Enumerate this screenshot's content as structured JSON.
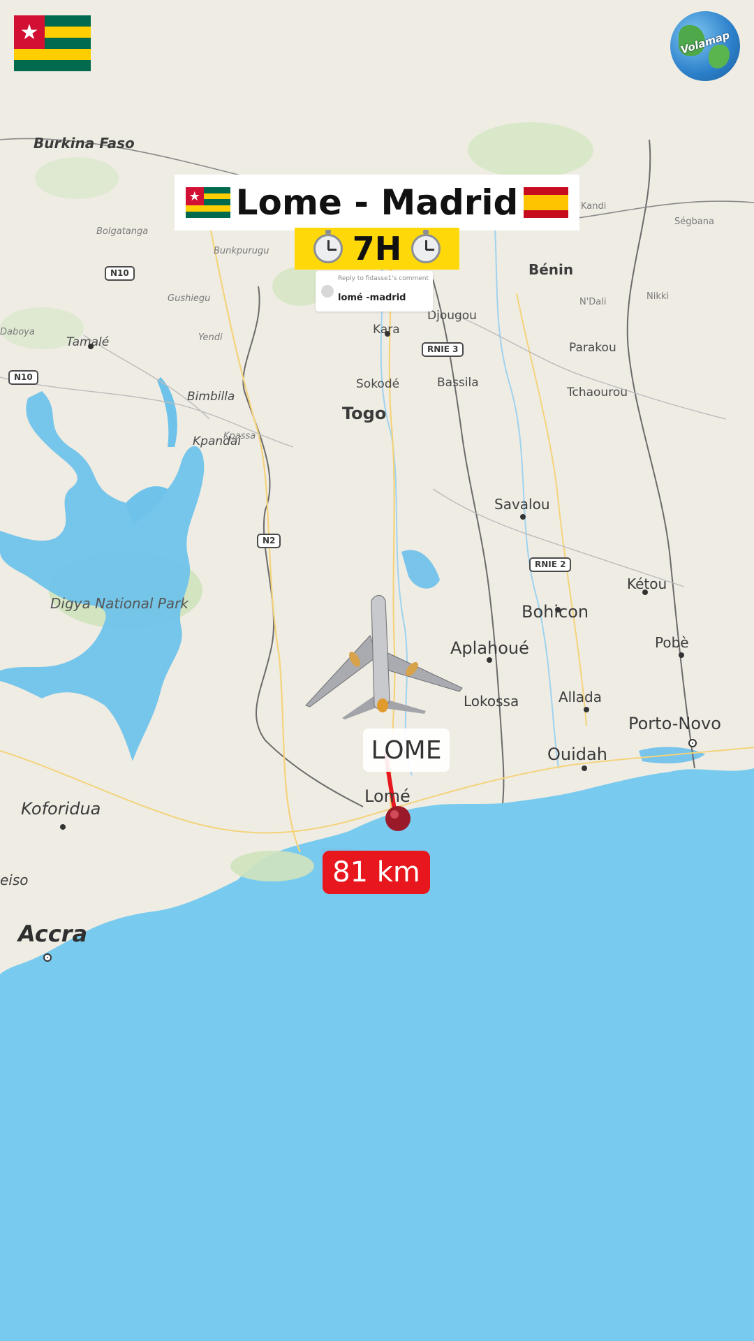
{
  "header": {
    "title": "Lome - Madrid",
    "duration": "7H",
    "origin_flag": "togo-flag",
    "destination_flag": "spain-flag",
    "clock_icon": "alarm-clock-icon"
  },
  "reply": {
    "header": "Reply to fidasse1's comment",
    "comment": "lomé -madrid"
  },
  "map": {
    "route_label": "LOME",
    "distance": "81 km",
    "labels": {
      "burkina_faso": "Burkina Faso",
      "benin": "Bénin",
      "togo": "Togo",
      "tamale": "Tamalé",
      "yendi": "Yendi",
      "bimbilla": "Bimbilla",
      "kpandai": "Kpandai",
      "kpassa": "Kpassa",
      "kara": "Kara",
      "djougou": "Djougou",
      "sokode": "Sokodé",
      "bassila": "Bassila",
      "parakou": "Parakou",
      "ndali": "N'Dali",
      "nikki": "Nikki",
      "kandi": "Kandi",
      "segbana": "Ségbana",
      "tchaourou": "Tchaourou",
      "savalou": "Savalou",
      "ketou": "Kétou",
      "bohicon": "Bohicon",
      "aplahoue": "Aplahoué",
      "pobe": "Pobè",
      "lokossa": "Lokossa",
      "allada": "Allada",
      "porto_novo": "Porto-Novo",
      "ouidah": "Ouidah",
      "lome": "Lomé",
      "koforidua": "Koforidua",
      "accra": "Accra",
      "digya": "Digya National Park",
      "gushiegu": "Gushiegu",
      "bunkpurugu": "Bunkpurugu",
      "bolgatanga": "Bolgatanga",
      "daboya": "Daboya",
      "weiso": "eiso"
    },
    "shields": {
      "n10": "N10",
      "n10b": "N10",
      "n2": "N2",
      "rnie2": "RNIE 2",
      "rnie3": "RNIE 3"
    },
    "logo_text": "Volamap"
  }
}
